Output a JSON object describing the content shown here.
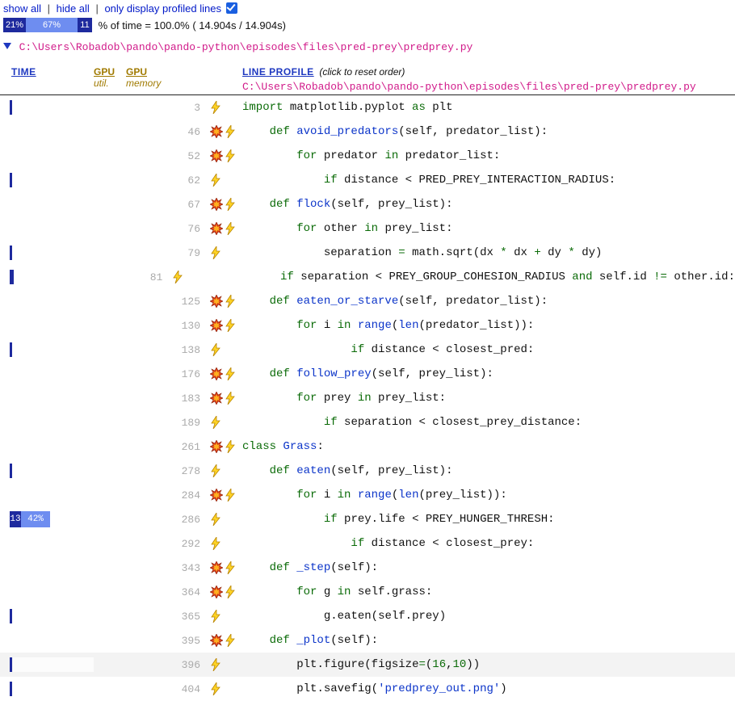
{
  "top": {
    "show_all": "show all",
    "hide_all": "hide all",
    "only_profiled": "only display profiled lines",
    "checked": true
  },
  "pctbar": {
    "seg1_label": "21%",
    "seg2_label": "67%",
    "seg3_label": "11",
    "text": "% of time = 100.0% ( 14.904s /  14.904s)"
  },
  "file_path": "C:\\Users\\Robadob\\pando\\pando-python\\episodes\\files\\pred-prey\\predprey.py",
  "headers": {
    "time": "TIME",
    "gpu": "GPU",
    "gpu_util": "util.",
    "gpu_mem": "memory",
    "line_profile": "LINE PROFILE",
    "reset": "(click to reset order)"
  },
  "rows": [
    {
      "lineno": 3,
      "tick": true,
      "boom": false,
      "bolt": true,
      "indent": 0,
      "tokens": [
        [
          "import ",
          "kw"
        ],
        [
          "matplotlib",
          "txt"
        ],
        [
          ".",
          "txt"
        ],
        [
          "pyplot ",
          "txt"
        ],
        [
          "as ",
          "kw"
        ],
        [
          "plt",
          "txt"
        ]
      ]
    },
    {
      "lineno": 46,
      "boom": true,
      "bolt": true,
      "indent": 1,
      "tokens": [
        [
          "def ",
          "kw"
        ],
        [
          "avoid_predators",
          "nm"
        ],
        [
          "(",
          "txt"
        ],
        [
          "self",
          "txt"
        ],
        [
          ", predator_list",
          "txt"
        ],
        [
          ")",
          "txt"
        ],
        [
          ":",
          "txt"
        ]
      ]
    },
    {
      "lineno": 52,
      "boom": true,
      "bolt": true,
      "indent": 2,
      "tokens": [
        [
          "for ",
          "kw"
        ],
        [
          "predator",
          "txt"
        ],
        [
          " in ",
          "kw"
        ],
        [
          "predator_list",
          "txt"
        ],
        [
          ":",
          "txt"
        ]
      ]
    },
    {
      "lineno": 62,
      "tick": true,
      "boom": false,
      "bolt": true,
      "indent": 3,
      "tokens": [
        [
          "if ",
          "kw"
        ],
        [
          "distance",
          "txt"
        ],
        [
          " < ",
          "txt"
        ],
        [
          "PRED_PREY_INTERACTION_RADIUS",
          "txt"
        ],
        [
          ":",
          "txt"
        ]
      ]
    },
    {
      "lineno": 67,
      "boom": true,
      "bolt": true,
      "indent": 1,
      "tokens": [
        [
          "def ",
          "kw"
        ],
        [
          "flock",
          "nm"
        ],
        [
          "(",
          "txt"
        ],
        [
          "self",
          "txt"
        ],
        [
          ", prey_list",
          "txt"
        ],
        [
          ")",
          "txt"
        ],
        [
          ":",
          "txt"
        ]
      ]
    },
    {
      "lineno": 76,
      "boom": true,
      "bolt": true,
      "indent": 2,
      "tokens": [
        [
          "for ",
          "kw"
        ],
        [
          "other",
          "txt"
        ],
        [
          " in ",
          "kw"
        ],
        [
          "prey_list",
          "txt"
        ],
        [
          ":",
          "txt"
        ]
      ]
    },
    {
      "lineno": 79,
      "tick": true,
      "boom": false,
      "bolt": true,
      "indent": 3,
      "tokens": [
        [
          "separation ",
          "txt"
        ],
        [
          "= ",
          "op"
        ],
        [
          "math",
          "txt"
        ],
        [
          ".",
          "txt"
        ],
        [
          "sqrt",
          "txt"
        ],
        [
          "(",
          "txt"
        ],
        [
          "dx",
          "txt"
        ],
        [
          " * ",
          "op"
        ],
        [
          "dx",
          "txt"
        ],
        [
          " + ",
          "op"
        ],
        [
          "dy",
          "txt"
        ],
        [
          " * ",
          "op"
        ],
        [
          "dy",
          "txt"
        ],
        [
          ")",
          "txt"
        ]
      ]
    },
    {
      "lineno": 81,
      "tick": true,
      "tickw": 5,
      "boom": false,
      "bolt": true,
      "indent": 3,
      "tokens": [
        [
          "if ",
          "kw"
        ],
        [
          "separation ",
          "txt"
        ],
        [
          "< ",
          "txt"
        ],
        [
          "PREY_GROUP_COHESION_RADIUS ",
          "txt"
        ],
        [
          "and ",
          "kw"
        ],
        [
          "self",
          "txt"
        ],
        [
          ".",
          "txt"
        ],
        [
          "id ",
          "txt"
        ],
        [
          "!= ",
          "op"
        ],
        [
          "other",
          "txt"
        ],
        [
          ".",
          "txt"
        ],
        [
          "id",
          "txt"
        ],
        [
          ":",
          "txt"
        ]
      ]
    },
    {
      "lineno": 125,
      "boom": true,
      "bolt": true,
      "indent": 1,
      "tokens": [
        [
          "def ",
          "kw"
        ],
        [
          "eaten_or_starve",
          "nm"
        ],
        [
          "(",
          "txt"
        ],
        [
          "self",
          "txt"
        ],
        [
          ", predator_list",
          "txt"
        ],
        [
          ")",
          "txt"
        ],
        [
          ":",
          "txt"
        ]
      ]
    },
    {
      "lineno": 130,
      "boom": true,
      "bolt": true,
      "indent": 2,
      "tokens": [
        [
          "for ",
          "kw"
        ],
        [
          "i",
          "txt"
        ],
        [
          " in ",
          "kw"
        ],
        [
          "range",
          "nm"
        ],
        [
          "(",
          "txt"
        ],
        [
          "len",
          "nm"
        ],
        [
          "(",
          "txt"
        ],
        [
          "predator_list",
          "txt"
        ],
        [
          "))",
          "txt"
        ],
        [
          ":",
          "txt"
        ]
      ]
    },
    {
      "lineno": 138,
      "tick": true,
      "boom": false,
      "bolt": true,
      "indent": 4,
      "tokens": [
        [
          "if ",
          "kw"
        ],
        [
          "distance",
          "txt"
        ],
        [
          " < ",
          "txt"
        ],
        [
          "closest_pred",
          "txt"
        ],
        [
          ":",
          "txt"
        ]
      ]
    },
    {
      "lineno": 176,
      "boom": true,
      "bolt": true,
      "indent": 1,
      "tokens": [
        [
          "def ",
          "kw"
        ],
        [
          "follow_prey",
          "nm"
        ],
        [
          "(",
          "txt"
        ],
        [
          "self",
          "txt"
        ],
        [
          ", prey_list",
          "txt"
        ],
        [
          ")",
          "txt"
        ],
        [
          ":",
          "txt"
        ]
      ]
    },
    {
      "lineno": 183,
      "boom": true,
      "bolt": true,
      "indent": 2,
      "tokens": [
        [
          "for ",
          "kw"
        ],
        [
          "prey",
          "txt"
        ],
        [
          " in ",
          "kw"
        ],
        [
          "prey_list",
          "txt"
        ],
        [
          ":",
          "txt"
        ]
      ]
    },
    {
      "lineno": 189,
      "boom": false,
      "bolt": true,
      "indent": 3,
      "tokens": [
        [
          "if ",
          "kw"
        ],
        [
          "separation",
          "txt"
        ],
        [
          " < ",
          "txt"
        ],
        [
          "closest_prey_distance",
          "txt"
        ],
        [
          ":",
          "txt"
        ]
      ]
    },
    {
      "lineno": 261,
      "boom": true,
      "bolt": true,
      "indent": 0,
      "tokens": [
        [
          "class ",
          "kw"
        ],
        [
          "Grass",
          "nm"
        ],
        [
          ":",
          "txt"
        ]
      ]
    },
    {
      "lineno": 278,
      "tick": true,
      "boom": false,
      "bolt": true,
      "indent": 1,
      "tokens": [
        [
          "def ",
          "kw"
        ],
        [
          "eaten",
          "nm"
        ],
        [
          "(",
          "txt"
        ],
        [
          "self",
          "txt"
        ],
        [
          ", prey_list",
          "txt"
        ],
        [
          ")",
          "txt"
        ],
        [
          ":",
          "txt"
        ]
      ]
    },
    {
      "lineno": 284,
      "boom": true,
      "bolt": true,
      "indent": 2,
      "tokens": [
        [
          "for ",
          "kw"
        ],
        [
          "i",
          "txt"
        ],
        [
          " in ",
          "kw"
        ],
        [
          "range",
          "nm"
        ],
        [
          "(",
          "txt"
        ],
        [
          "len",
          "nm"
        ],
        [
          "(",
          "txt"
        ],
        [
          "prey_list",
          "txt"
        ],
        [
          "))",
          "txt"
        ],
        [
          ":",
          "txt"
        ]
      ]
    },
    {
      "lineno": 286,
      "bar": {
        "a_label": "13",
        "a_w": 14,
        "b_label": "42%",
        "b_w": 36
      },
      "boom": false,
      "bolt": true,
      "indent": 3,
      "tokens": [
        [
          "if ",
          "kw"
        ],
        [
          "prey",
          "txt"
        ],
        [
          ".",
          "txt"
        ],
        [
          "life ",
          "txt"
        ],
        [
          "< ",
          "txt"
        ],
        [
          "PREY_HUNGER_THRESH",
          "txt"
        ],
        [
          ":",
          "txt"
        ]
      ]
    },
    {
      "lineno": 292,
      "boom": false,
      "bolt": true,
      "indent": 4,
      "tokens": [
        [
          "if ",
          "kw"
        ],
        [
          "distance",
          "txt"
        ],
        [
          " < ",
          "txt"
        ],
        [
          "closest_prey",
          "txt"
        ],
        [
          ":",
          "txt"
        ]
      ]
    },
    {
      "lineno": 343,
      "boom": true,
      "bolt": true,
      "indent": 1,
      "tokens": [
        [
          "def ",
          "kw"
        ],
        [
          "_step",
          "nm"
        ],
        [
          "(",
          "txt"
        ],
        [
          "self",
          "txt"
        ],
        [
          ")",
          "txt"
        ],
        [
          ":",
          "txt"
        ]
      ]
    },
    {
      "lineno": 364,
      "boom": true,
      "bolt": true,
      "indent": 2,
      "tokens": [
        [
          "for ",
          "kw"
        ],
        [
          "g",
          "txt"
        ],
        [
          " in ",
          "kw"
        ],
        [
          "self",
          "txt"
        ],
        [
          ".",
          "txt"
        ],
        [
          "grass",
          "txt"
        ],
        [
          ":",
          "txt"
        ]
      ]
    },
    {
      "lineno": 365,
      "tick": true,
      "boom": false,
      "bolt": true,
      "indent": 3,
      "tokens": [
        [
          "g",
          "txt"
        ],
        [
          ".",
          "txt"
        ],
        [
          "eaten",
          "txt"
        ],
        [
          "(",
          "txt"
        ],
        [
          "self",
          "txt"
        ],
        [
          ".",
          "txt"
        ],
        [
          "prey",
          "txt"
        ],
        [
          ")",
          "txt"
        ]
      ]
    },
    {
      "lineno": 395,
      "boom": true,
      "bolt": true,
      "indent": 1,
      "tokens": [
        [
          "def ",
          "kw"
        ],
        [
          "_plot",
          "nm"
        ],
        [
          "(",
          "txt"
        ],
        [
          "self",
          "txt"
        ],
        [
          ")",
          "txt"
        ],
        [
          ":",
          "txt"
        ]
      ]
    },
    {
      "lineno": 396,
      "alt": true,
      "tick": true,
      "tickalt": true,
      "boom": false,
      "bolt": true,
      "indent": 2,
      "tokens": [
        [
          "plt",
          "txt"
        ],
        [
          ".",
          "txt"
        ],
        [
          "figure",
          "txt"
        ],
        [
          "(",
          "txt"
        ],
        [
          "figsize",
          "txt"
        ],
        [
          "=",
          "op"
        ],
        [
          "(",
          "txt"
        ],
        [
          "16",
          "num"
        ],
        [
          ",",
          "txt"
        ],
        [
          "10",
          "num"
        ],
        [
          "))",
          "txt"
        ]
      ]
    },
    {
      "lineno": 404,
      "tick": true,
      "boom": false,
      "bolt": true,
      "indent": 2,
      "tokens": [
        [
          "plt",
          "txt"
        ],
        [
          ".",
          "txt"
        ],
        [
          "savefig",
          "txt"
        ],
        [
          "(",
          "txt"
        ],
        [
          "'predprey_out.png'",
          "nm"
        ],
        [
          ")",
          "txt"
        ]
      ]
    }
  ],
  "colors": {
    "darkblue": "#1e2a9e",
    "lightblue": "#6e8df0",
    "alt_light": "#f6f6f6"
  }
}
